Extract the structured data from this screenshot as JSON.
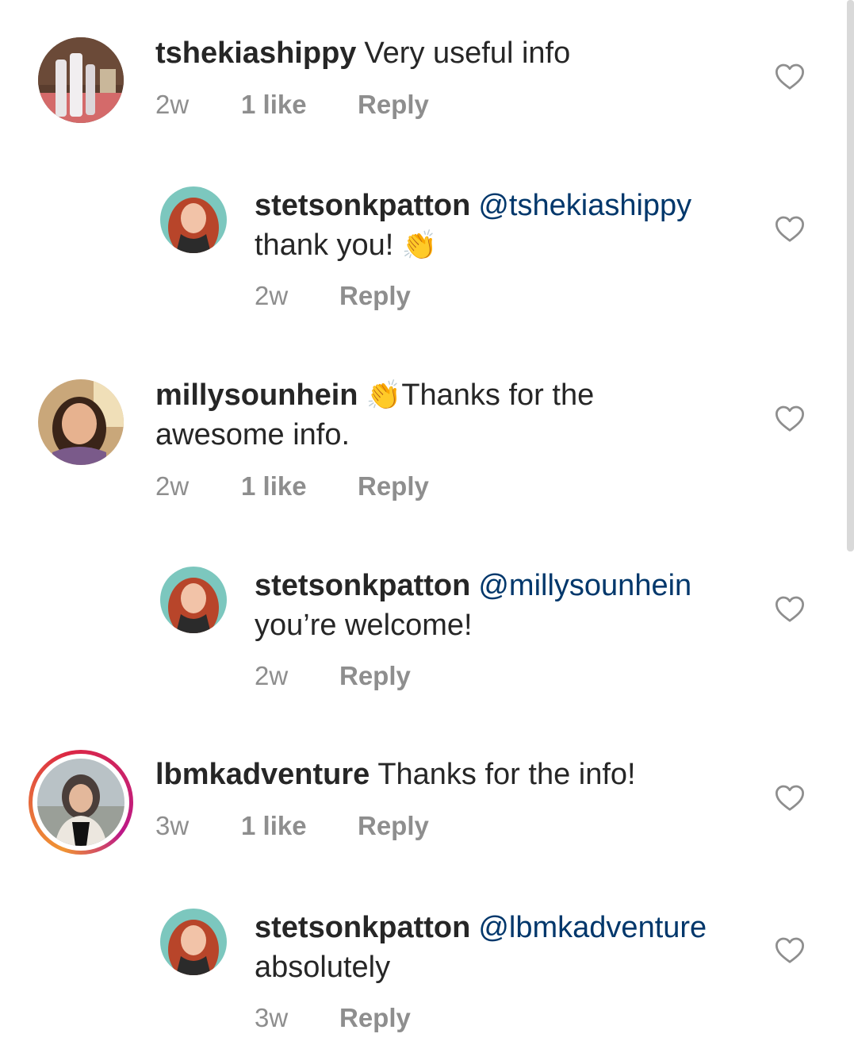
{
  "comments": [
    {
      "username": "tshekiashippy",
      "text": "Very useful info",
      "time": "2w",
      "likes": "1 like",
      "reply": "Reply"
    },
    {
      "username": "stetsonkpatton",
      "mention": "@tshekiashippy",
      "text": "thank you!",
      "emoji": "👏",
      "time": "2w",
      "reply": "Reply"
    },
    {
      "username": "millysounhein",
      "emoji": "👏",
      "text": "Thanks for the awesome info.",
      "time": "2w",
      "likes": "1 like",
      "reply": "Reply"
    },
    {
      "username": "stetsonkpatton",
      "mention": "@millysounhein",
      "text": "you’re welcome!",
      "time": "2w",
      "reply": "Reply"
    },
    {
      "username": "lbmkadventure",
      "text": "Thanks for the info!",
      "time": "3w",
      "likes": "1 like",
      "reply": "Reply"
    },
    {
      "username": "stetsonkpatton",
      "mention": "@lbmkadventure",
      "text": "absolutely",
      "time": "3w",
      "reply": "Reply"
    }
  ],
  "colors": {
    "text": "#262626",
    "meta": "#8e8e8e",
    "mention": "#00376b",
    "background": "#ffffff"
  },
  "icons": {
    "like": "heart-outline-icon"
  }
}
